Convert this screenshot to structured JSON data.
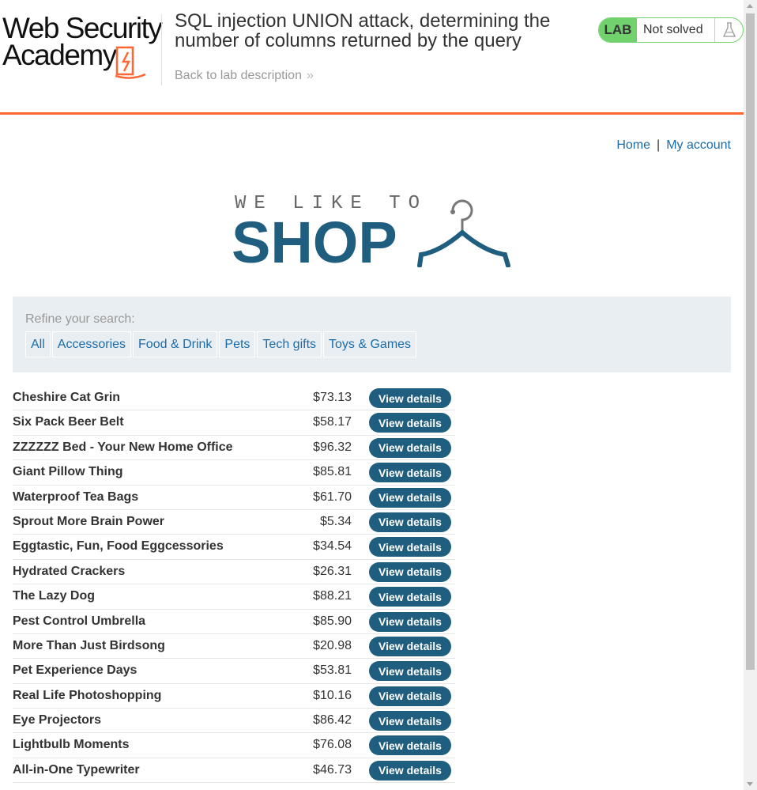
{
  "header": {
    "logo_line1": "Web Security",
    "logo_line2": "Academy",
    "lab_title": "SQL injection UNION attack, determining the number of columns returned by the query",
    "back_link": "Back to lab description",
    "back_chevron": "»",
    "lab_badge": "LAB",
    "lab_status": "Not solved",
    "colors": {
      "accent": "#ff6633",
      "badge_green": "#70d16d"
    }
  },
  "nav": {
    "home": "Home",
    "separator": "|",
    "account": "My account"
  },
  "shop_logo": {
    "tagline": "WE LIKE TO",
    "word": "SHOP",
    "icon": "hanger-icon",
    "color": "#1f5e7e"
  },
  "filter": {
    "label": "Refine your search:",
    "categories": [
      "All",
      "Accessories",
      "Food & Drink",
      "Pets",
      "Tech gifts",
      "Toys & Games"
    ]
  },
  "products": {
    "button_label": "View details",
    "items": [
      {
        "name": "Cheshire Cat Grin",
        "price": "$73.13"
      },
      {
        "name": "Six Pack Beer Belt",
        "price": "$58.17"
      },
      {
        "name": "ZZZZZZ Bed - Your New Home Office",
        "price": "$96.32"
      },
      {
        "name": "Giant Pillow Thing",
        "price": "$85.81"
      },
      {
        "name": "Waterproof Tea Bags",
        "price": "$61.70"
      },
      {
        "name": "Sprout More Brain Power",
        "price": "$5.34"
      },
      {
        "name": "Eggtastic, Fun, Food Eggcessories",
        "price": "$34.54"
      },
      {
        "name": "Hydrated Crackers",
        "price": "$26.31"
      },
      {
        "name": "The Lazy Dog",
        "price": "$88.21"
      },
      {
        "name": "Pest Control Umbrella",
        "price": "$85.90"
      },
      {
        "name": "More Than Just Birdsong",
        "price": "$20.98"
      },
      {
        "name": "Pet Experience Days",
        "price": "$53.81"
      },
      {
        "name": "Real Life Photoshopping",
        "price": "$10.16"
      },
      {
        "name": "Eye Projectors",
        "price": "$86.42"
      },
      {
        "name": "Lightbulb Moments",
        "price": "$76.08"
      },
      {
        "name": "All-in-One Typewriter",
        "price": "$46.73"
      }
    ]
  }
}
